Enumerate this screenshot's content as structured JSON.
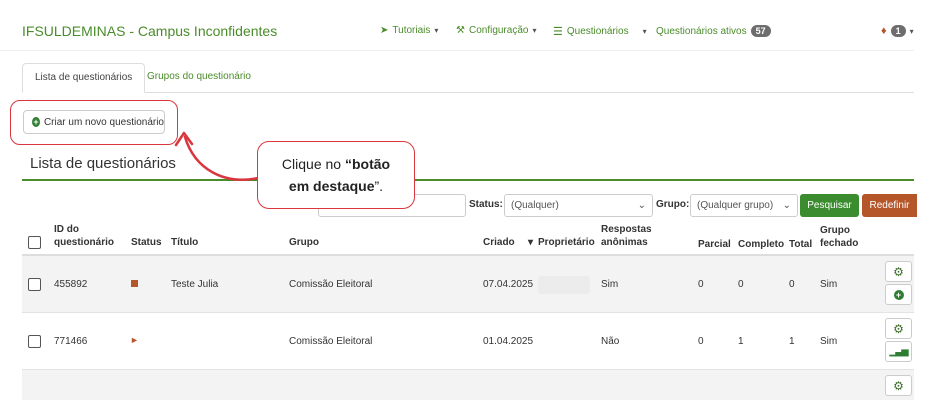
{
  "navbar": {
    "brand": "IFSULDEMINAS - Campus Inconfidentes",
    "tutorials": "Tutoriais",
    "configuration": "Configuração",
    "questionnaires": "Questionários",
    "active_questionnaires": "Questionários ativos",
    "active_count": "57",
    "notification_count": "1"
  },
  "tabs": {
    "list": "Lista de questionários",
    "groups": "Grupos do questionário"
  },
  "create_button": "Criar um novo questionário",
  "section_title": "Lista de questionários",
  "callout": {
    "line1_prefix": "Clique no ",
    "line1_bold": "“botão",
    "line2_bold": "em destaque",
    "line2_suffix": "”."
  },
  "filters": {
    "status_label": "Status:",
    "status_value": "(Qualquer)",
    "group_label": "Grupo:",
    "group_value": "(Qualquer grupo)",
    "search_button": "Pesquisar",
    "reset_button": "Redefinir"
  },
  "table": {
    "headers": {
      "id_line1": "ID do",
      "id_line2": "questionário",
      "status": "Status",
      "title": "Título",
      "group": "Grupo",
      "created": "Criado",
      "owner": "Proprietário",
      "anon_line1": "Respostas",
      "anon_line2": "anônimas",
      "partial": "Parcial",
      "complete": "Completo",
      "total": "Total",
      "closed_line1": "Grupo",
      "closed_line2": "fechado"
    },
    "rows": [
      {
        "id": "455892",
        "title": "Teste Julia",
        "group": "Comissão Eleitoral",
        "created": "07.04.2025",
        "anonymous": "Sim",
        "partial": "0",
        "complete": "0",
        "total": "0",
        "closed": "Sim"
      },
      {
        "id": "771466",
        "title": "",
        "group": "Comissão Eleitoral",
        "created": "01.04.2025",
        "anonymous": "Não",
        "partial": "0",
        "complete": "1",
        "total": "1",
        "closed": "Sim"
      }
    ]
  },
  "icons": {
    "brand_color": "#4a8c2a",
    "highlight_color": "#d9363e",
    "status_color": "#b4552a"
  }
}
